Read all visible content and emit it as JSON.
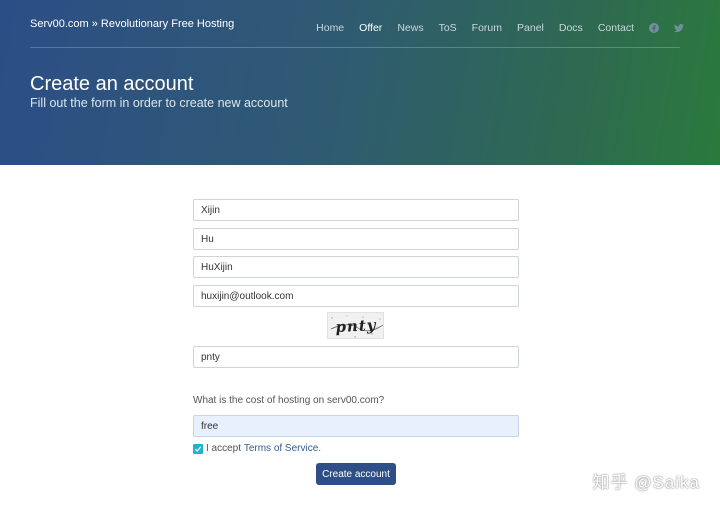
{
  "header": {
    "brand": "Serv00.com » Revolutionary Free Hosting",
    "nav": [
      {
        "label": "Home",
        "active": false
      },
      {
        "label": "Offer",
        "active": true
      },
      {
        "label": "News",
        "active": false
      },
      {
        "label": "ToS",
        "active": false
      },
      {
        "label": "Forum",
        "active": false
      },
      {
        "label": "Panel",
        "active": false
      },
      {
        "label": "Docs",
        "active": false
      },
      {
        "label": "Contact",
        "active": false
      }
    ],
    "social": [
      "facebook-icon",
      "twitter-icon"
    ],
    "title": "Create an account",
    "subtitle": "Fill out the form in order to create new account"
  },
  "form": {
    "first_name": "Xijin",
    "last_name": "Hu",
    "username": "HuXijin",
    "email": "huxijin@outlook.com",
    "captcha_image_text": "pnty",
    "captcha_answer": "pnty",
    "question": "What is the cost of hosting on serv00.com?",
    "answer": "free",
    "tos_prefix": "I accept ",
    "tos_link": "Terms of Service",
    "tos_suffix": ".",
    "tos_checked": true,
    "submit_label": "Create account"
  },
  "watermark": "知乎 @Saika",
  "colors": {
    "accent": "#2d4f86",
    "checkbox": "#1eb3cf",
    "link": "#2e5d8e"
  }
}
